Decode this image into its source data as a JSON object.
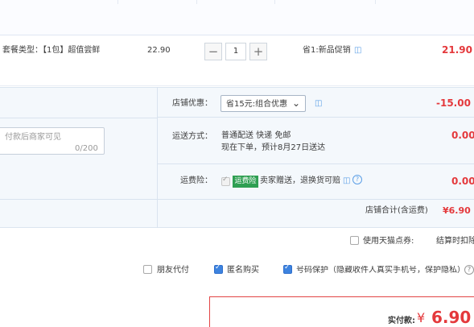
{
  "item": {
    "package_label": "套餐类型：【1包】超值尝鲜",
    "unit_price": "22.90",
    "quantity": "1",
    "promotion": "省1:新品促销",
    "subtotal": "21.90"
  },
  "shop": {
    "discount_label": "店铺优惠：",
    "discount_select": "省15元:组合优惠",
    "discount_amount": "-15.00",
    "message_placeholder": "付款后商家可见",
    "message_count": "0/200",
    "delivery_label": "运送方式：",
    "delivery_line1": "普通配送 快递 免邮",
    "delivery_line2": "现在下单，预计8月27日送达",
    "delivery_amount": "0.00",
    "insurance_label": "运费险：",
    "insurance_badge": "运费险",
    "insurance_text": "卖家赠送，退换货可赔",
    "insurance_amount": "0.00",
    "total_label": "店铺合计(含运费)",
    "total_amount": "¥6.90"
  },
  "options": {
    "tmall_points": "使用天猫点券:",
    "settle_deduction": "结算时扣除",
    "friend_pay": "朋友代付",
    "anonymous": "匿名购买",
    "number_protect": "号码保护（隐藏收件人真实手机号，保护隐私）"
  },
  "payment": {
    "label": "实付款:",
    "currency": "¥",
    "amount": "6.90"
  },
  "colors": {
    "accent_red": "#e4393c",
    "checkbox_blue": "#3d83df",
    "badge_green": "#2f9f52"
  }
}
